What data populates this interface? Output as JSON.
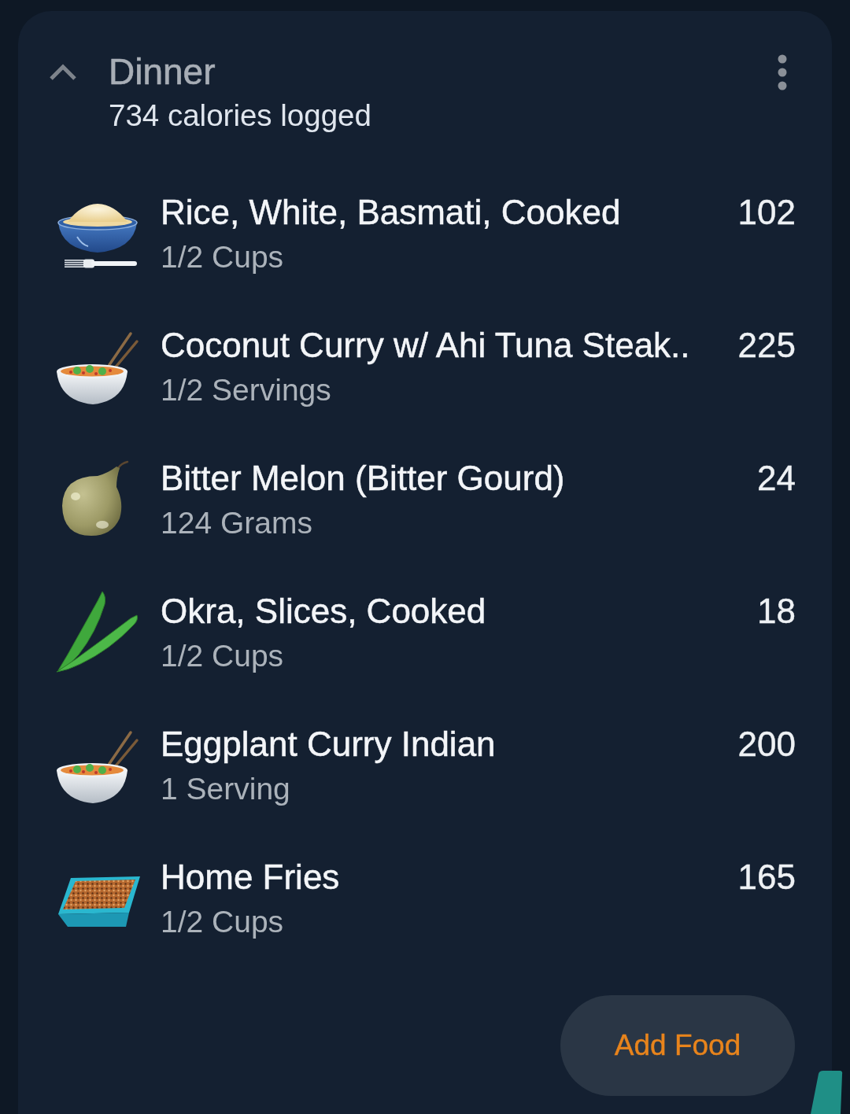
{
  "meal": {
    "title": "Dinner",
    "subtitle": "734 calories logged",
    "expanded": true
  },
  "foods": [
    {
      "kind": "rice",
      "name": "Rice, White, Basmati, Cooked",
      "serving": "1/2 Cups",
      "calories": "102"
    },
    {
      "kind": "noodles",
      "name": "Coconut Curry w/ Ahi Tuna Steak..",
      "serving": "1/2 Servings",
      "calories": "225"
    },
    {
      "kind": "gourd",
      "name": "Bitter Melon (Bitter Gourd)",
      "serving": "124 Grams",
      "calories": "24"
    },
    {
      "kind": "okra",
      "name": "Okra, Slices, Cooked",
      "serving": "1/2 Cups",
      "calories": "18"
    },
    {
      "kind": "noodles",
      "name": "Eggplant Curry Indian",
      "serving": "1 Serving",
      "calories": "200"
    },
    {
      "kind": "fries",
      "name": "Home Fries",
      "serving": "1/2 Cups",
      "calories": "165"
    }
  ],
  "add_button": {
    "label": "Add Food"
  }
}
